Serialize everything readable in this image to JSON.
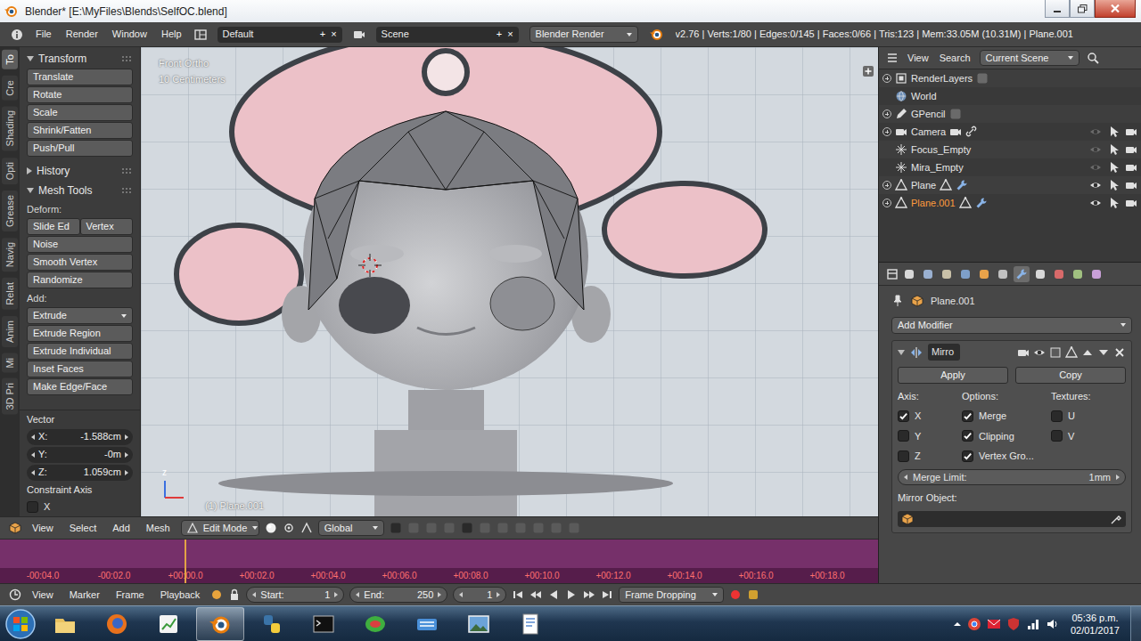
{
  "window": {
    "title": "Blender* [E:\\MyFiles\\Blends\\SelfOC.blend]"
  },
  "info_header": {
    "menus": [
      "File",
      "Render",
      "Window",
      "Help"
    ],
    "layout": "Default",
    "layout_actions": [
      "+",
      "×"
    ],
    "scene": "Scene",
    "scene_actions": [
      "+",
      "×"
    ],
    "engine": "Blender Render",
    "stats": "v2.76 | Verts:1/80 | Edges:0/145 | Faces:0/66 | Tris:123 | Mem:33.05M (10.31M) | Plane.001"
  },
  "tool_shelf": {
    "tabs": [
      {
        "label": "To",
        "selected": true
      },
      {
        "label": "Cre",
        "selected": false
      },
      {
        "label": "Shading",
        "selected": false
      },
      {
        "label": "Opti",
        "selected": false
      },
      {
        "label": "Grease",
        "selected": false
      },
      {
        "label": "Navig",
        "selected": false
      },
      {
        "label": "Relat",
        "selected": false
      },
      {
        "label": "Anim",
        "selected": false
      },
      {
        "label": "Mi",
        "selected": false
      },
      {
        "label": "3D Pri",
        "selected": false
      }
    ],
    "panels": [
      {
        "title": "Transform",
        "expanded": true,
        "rows": [
          {
            "kind": "button",
            "label": "Translate"
          },
          {
            "kind": "button",
            "label": "Rotate"
          },
          {
            "kind": "button",
            "label": "Scale"
          },
          {
            "kind": "button",
            "label": "Shrink/Fatten"
          },
          {
            "kind": "button",
            "label": "Push/Pull"
          }
        ]
      },
      {
        "title": "History",
        "expanded": false,
        "rows": []
      },
      {
        "title": "Mesh Tools",
        "expanded": true,
        "rows": [
          {
            "kind": "label",
            "label": "Deform:"
          },
          {
            "kind": "pair",
            "labels": [
              "Slide Ed",
              "Vertex"
            ]
          },
          {
            "kind": "button",
            "label": "Noise"
          },
          {
            "kind": "button",
            "label": "Smooth Vertex"
          },
          {
            "kind": "button",
            "label": "Randomize"
          },
          {
            "kind": "label",
            "label": "Add:"
          },
          {
            "kind": "dropdown",
            "label": "Extrude"
          },
          {
            "kind": "button",
            "label": "Extrude Region"
          },
          {
            "kind": "button",
            "label": "Extrude Individual"
          },
          {
            "kind": "button",
            "label": "Inset Faces"
          },
          {
            "kind": "button",
            "label": "Make Edge/Face"
          }
        ]
      }
    ],
    "operator": {
      "title": "Vector",
      "fields": [
        {
          "label": "X:",
          "value": "-1.588cm"
        },
        {
          "label": "Y:",
          "value": "-0m"
        },
        {
          "label": "Z:",
          "value": "1.059cm"
        }
      ],
      "constraint_label": "Constraint Axis",
      "constraints": [
        {
          "label": "X",
          "checked": false
        }
      ]
    }
  },
  "viewport": {
    "view_name": "Front Ortho",
    "scale": "10 Centimeters",
    "object_label": "(1) Plane.001",
    "axis_label": "z"
  },
  "view3d_header": {
    "menus": [
      "View",
      "Select",
      "Add",
      "Mesh"
    ],
    "mode": "Edit Mode",
    "orientation": "Global"
  },
  "timeline": {
    "ticks": [
      "-00:04.0",
      "-00:02.0",
      "+00:00.0",
      "+00:02.0",
      "+00:04.0",
      "+00:06.0",
      "+00:08.0",
      "+00:10.0",
      "+00:12.0",
      "+00:14.0",
      "+00:16.0",
      "+00:18.0"
    ],
    "playhead": {
      "level": 0.21
    }
  },
  "timeline_header": {
    "menus": [
      "View",
      "Marker",
      "Frame",
      "Playback"
    ],
    "start_label": "Start:",
    "start": "1",
    "end_label": "End:",
    "end": "250",
    "current_frame": "1",
    "sync": "Frame Dropping"
  },
  "outliner": {
    "menus": [
      "View",
      "Search"
    ],
    "display": "Current Scene",
    "items": [
      {
        "name": "RenderLayers",
        "kind": "layers",
        "selected": false,
        "expandable": true,
        "expanded": false
      },
      {
        "name": "World",
        "kind": "world",
        "selected": false,
        "expandable": false,
        "expanded": false
      },
      {
        "name": "GPencil",
        "kind": "gpencil",
        "selected": false,
        "expandable": true,
        "expanded": false
      },
      {
        "name": "Camera",
        "kind": "camera",
        "selected": false,
        "expandable": true,
        "expanded": false,
        "visible": false
      },
      {
        "name": "Focus_Empty",
        "kind": "empty",
        "selected": false,
        "expandable": false,
        "expanded": false,
        "visible": false
      },
      {
        "name": "Mira_Empty",
        "kind": "empty",
        "selected": false,
        "expandable": false,
        "expanded": false,
        "visible": false
      },
      {
        "name": "Plane",
        "kind": "mesh",
        "selected": false,
        "expandable": true,
        "expanded": false,
        "visible": true
      },
      {
        "name": "Plane.001",
        "kind": "mesh",
        "selected": true,
        "expandable": true,
        "expanded": false,
        "visible": true
      }
    ]
  },
  "properties": {
    "tabs": [
      {
        "selected": false
      },
      {
        "selected": false
      },
      {
        "selected": false
      },
      {
        "selected": false
      },
      {
        "selected": false
      },
      {
        "selected": false
      },
      {
        "selected": true
      },
      {
        "selected": false
      },
      {
        "selected": false
      },
      {
        "selected": false
      },
      {
        "selected": false
      }
    ],
    "object_name": "Plane.001",
    "add_modifier": "Add Modifier",
    "modifier": {
      "name": "Mirro",
      "expanded": true,
      "apply": "Apply",
      "copy": "Copy",
      "axis_label": "Axis:",
      "options_label": "Options:",
      "textures_label": "Textures:",
      "axes": [
        {
          "label": "X",
          "checked": true
        },
        {
          "label": "Y",
          "checked": false
        },
        {
          "label": "Z",
          "checked": false
        }
      ],
      "options": [
        {
          "label": "Merge",
          "checked": true
        },
        {
          "label": "Clipping",
          "checked": true
        },
        {
          "label": "Vertex Gro...",
          "checked": true
        }
      ],
      "textures": [
        {
          "label": "U",
          "checked": false
        },
        {
          "label": "V",
          "checked": false
        }
      ],
      "merge_limit_label": "Merge Limit:",
      "merge_limit": "1mm",
      "mirror_object_label": "Mirror Object:"
    }
  },
  "taskbar": {
    "apps": [
      {
        "kind": "folder",
        "selected": false
      },
      {
        "kind": "firefox",
        "selected": false
      },
      {
        "kind": "chart",
        "selected": false
      },
      {
        "kind": "blender",
        "selected": true
      },
      {
        "kind": "python",
        "selected": false
      },
      {
        "kind": "terminal",
        "selected": false
      },
      {
        "kind": "lizard",
        "selected": false
      },
      {
        "kind": "keyboard",
        "selected": false
      },
      {
        "kind": "photo",
        "selected": false
      },
      {
        "kind": "editor",
        "selected": false
      }
    ],
    "time": "05:36 p.m.",
    "date": "02/01/2017"
  }
}
